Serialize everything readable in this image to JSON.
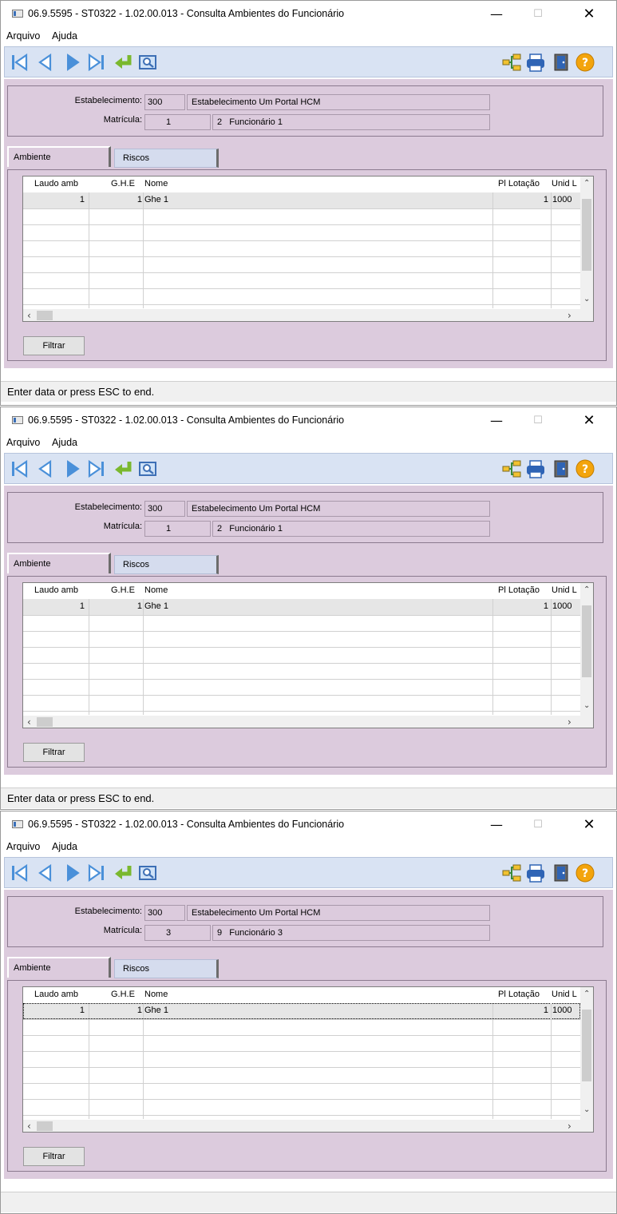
{
  "windows": [
    {
      "title": "06.9.5595 - ST0322 - 1.02.00.013 - Consulta Ambientes do Funcionário",
      "menu": [
        "Arquivo",
        "Ajuda"
      ],
      "form": {
        "estabelecimento_label": "Estabelecimento:",
        "estabelecimento_code": "300",
        "estabelecimento_name": "Estabelecimento Um Portal HCM",
        "matricula_label": "Matrícula:",
        "matricula_num": "1",
        "matricula_digit": "2",
        "funcionario_name": "Funcionário 1"
      },
      "tabs": [
        "Ambiente",
        "Riscos"
      ],
      "grid": {
        "headers": [
          "Laudo amb",
          "G.H.E",
          "Nome",
          "Pl Lotação",
          "Unid L"
        ],
        "rows": [
          [
            "1",
            "1",
            "Ghe 1",
            "1",
            "1000"
          ]
        ]
      },
      "filter_label": "Filtrar",
      "status": "Enter data or press ESC to end."
    },
    {
      "title": "06.9.5595 - ST0322 - 1.02.00.013 - Consulta Ambientes do Funcionário",
      "menu": [
        "Arquivo",
        "Ajuda"
      ],
      "form": {
        "estabelecimento_label": "Estabelecimento:",
        "estabelecimento_code": "300",
        "estabelecimento_name": "Estabelecimento Um Portal HCM",
        "matricula_label": "Matrícula:",
        "matricula_num": "1",
        "matricula_digit": "2",
        "funcionario_name": "Funcionário 1"
      },
      "tabs": [
        "Ambiente",
        "Riscos"
      ],
      "grid": {
        "headers": [
          "Laudo amb",
          "G.H.E",
          "Nome",
          "Pl Lotação",
          "Unid L"
        ],
        "rows": [
          [
            "1",
            "1",
            "Ghe 1",
            "1",
            "1000"
          ]
        ]
      },
      "filter_label": "Filtrar",
      "status": "Enter data or press ESC to end."
    },
    {
      "title": "06.9.5595 - ST0322 - 1.02.00.013 - Consulta Ambientes do Funcionário",
      "menu": [
        "Arquivo",
        "Ajuda"
      ],
      "form": {
        "estabelecimento_label": "Estabelecimento:",
        "estabelecimento_code": "300",
        "estabelecimento_name": "Estabelecimento Um Portal HCM",
        "matricula_label": "Matrícula:",
        "matricula_num": "3",
        "matricula_digit": "9",
        "funcionario_name": "Funcionário 3"
      },
      "tabs": [
        "Ambiente",
        "Riscos"
      ],
      "grid": {
        "headers": [
          "Laudo amb",
          "G.H.E",
          "Nome",
          "Pl Lotação",
          "Unid L"
        ],
        "rows": [
          [
            "1",
            "1",
            "Ghe 1",
            "1",
            "1000"
          ]
        ]
      },
      "filter_label": "Filtrar",
      "status": ""
    }
  ],
  "toolbar_icons": [
    "first-record-icon",
    "previous-record-icon",
    "next-record-icon",
    "last-record-icon",
    "return-icon",
    "search-icon",
    "hierarchy-icon",
    "print-icon",
    "exit-door-icon",
    "help-icon"
  ],
  "colors": {
    "form_background": "#dccbdd",
    "toolbar_background": "#d9e3f3",
    "nav_arrow": "#4a90d9",
    "return_arrow": "#7ab82e",
    "help_icon": "#f3a40c"
  }
}
